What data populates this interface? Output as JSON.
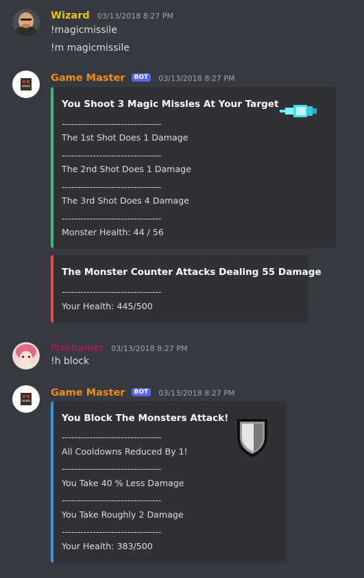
{
  "messages": {
    "m1": {
      "author": "Wizard",
      "author_color": "#f1c40f",
      "timestamp": "03/13/2018 8:27 PM",
      "lines": [
        "!magicmissile",
        "!m magicmissile"
      ]
    },
    "m2": {
      "author": "Game Master",
      "author_color": "#f48c1b",
      "bot_tag": "BOT",
      "timestamp": "03/13/2018 8:27 PM",
      "embed1": {
        "color": "#43b581",
        "title": "You Shoot 3 Magic Missles At Your Target",
        "thumbnail_icon": "magic-missile-icon",
        "lines": [
          "--------------------------------",
          "The 1st Shot Does 1 Damage",
          "--------------------------------",
          "The 2nd Shot Does 1 Damage",
          "--------------------------------",
          "The 3rd Shot Does 4 Damage",
          "--------------------------------",
          "Monster Health: 44 / 56"
        ]
      },
      "embed2": {
        "color": "#e74c3c",
        "title": "The Monster Counter Attacks Dealing 55 Damage",
        "lines": [
          "--------------------------------",
          "Your Health: 445/500"
        ]
      }
    },
    "m3": {
      "author": "Pixeltamer",
      "author_color": "#c2185b",
      "timestamp": "03/13/2018 8:27 PM",
      "lines": [
        "!h block"
      ]
    },
    "m4": {
      "author": "Game Master",
      "author_color": "#f48c1b",
      "bot_tag": "BOT",
      "timestamp": "03/13/2018 8:27 PM",
      "embed1": {
        "color": "#3498db",
        "title": "You Block The Monsters Attack!",
        "thumbnail_icon": "shield-icon",
        "lines": [
          "--------------------------------",
          "All Cooldowns Reduced By 1!",
          "--------------------------------",
          "You Take 40 % Less Damage",
          "--------------------------------",
          "You Take Roughly 2 Damage",
          "--------------------------------",
          "Your Health: 383/500"
        ]
      }
    }
  }
}
